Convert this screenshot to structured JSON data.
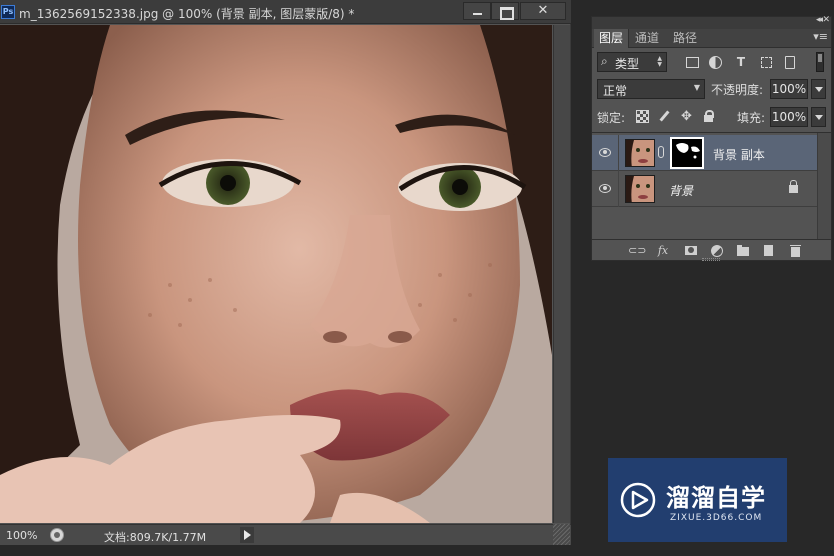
{
  "document": {
    "app_badge": "Ps",
    "title": "m_1362569152338.jpg @ 100% (背景 副本, 图层蒙版/8) *",
    "status": {
      "zoom": "100%",
      "info": "文档:809.7K/1.77M"
    }
  },
  "layers_panel": {
    "tabs": [
      {
        "label": "图层",
        "active": true
      },
      {
        "label": "通道",
        "active": false
      },
      {
        "label": "路径",
        "active": false
      }
    ],
    "filter": {
      "label": "类型",
      "search_icon": "⌕"
    },
    "filter_type_icon": "T",
    "move_icon": "✥",
    "blend_mode": "正常",
    "opacity": {
      "label": "不透明度:",
      "value": "100%"
    },
    "lock": {
      "label": "锁定:"
    },
    "fill": {
      "label": "填充:",
      "value": "100%"
    },
    "layers": [
      {
        "name": "背景 副本",
        "selected": true,
        "has_mask": true,
        "locked": false,
        "visible": true
      },
      {
        "name": "背景",
        "selected": false,
        "has_mask": false,
        "locked": true,
        "visible": true
      }
    ],
    "footer_icons": [
      "link-icon",
      "fx-icon",
      "mask-icon",
      "adjustment-icon",
      "group-icon",
      "new-layer-icon",
      "trash-icon"
    ],
    "footer_fx": "fx"
  },
  "watermark": {
    "brand": "溜溜自学",
    "url": "ZIXUE.3D66.COM"
  },
  "colors": {
    "ui_dark": "#282828",
    "panel": "#535353",
    "selected_layer": "#5a6577",
    "watermark_bg": "#223e6f"
  }
}
